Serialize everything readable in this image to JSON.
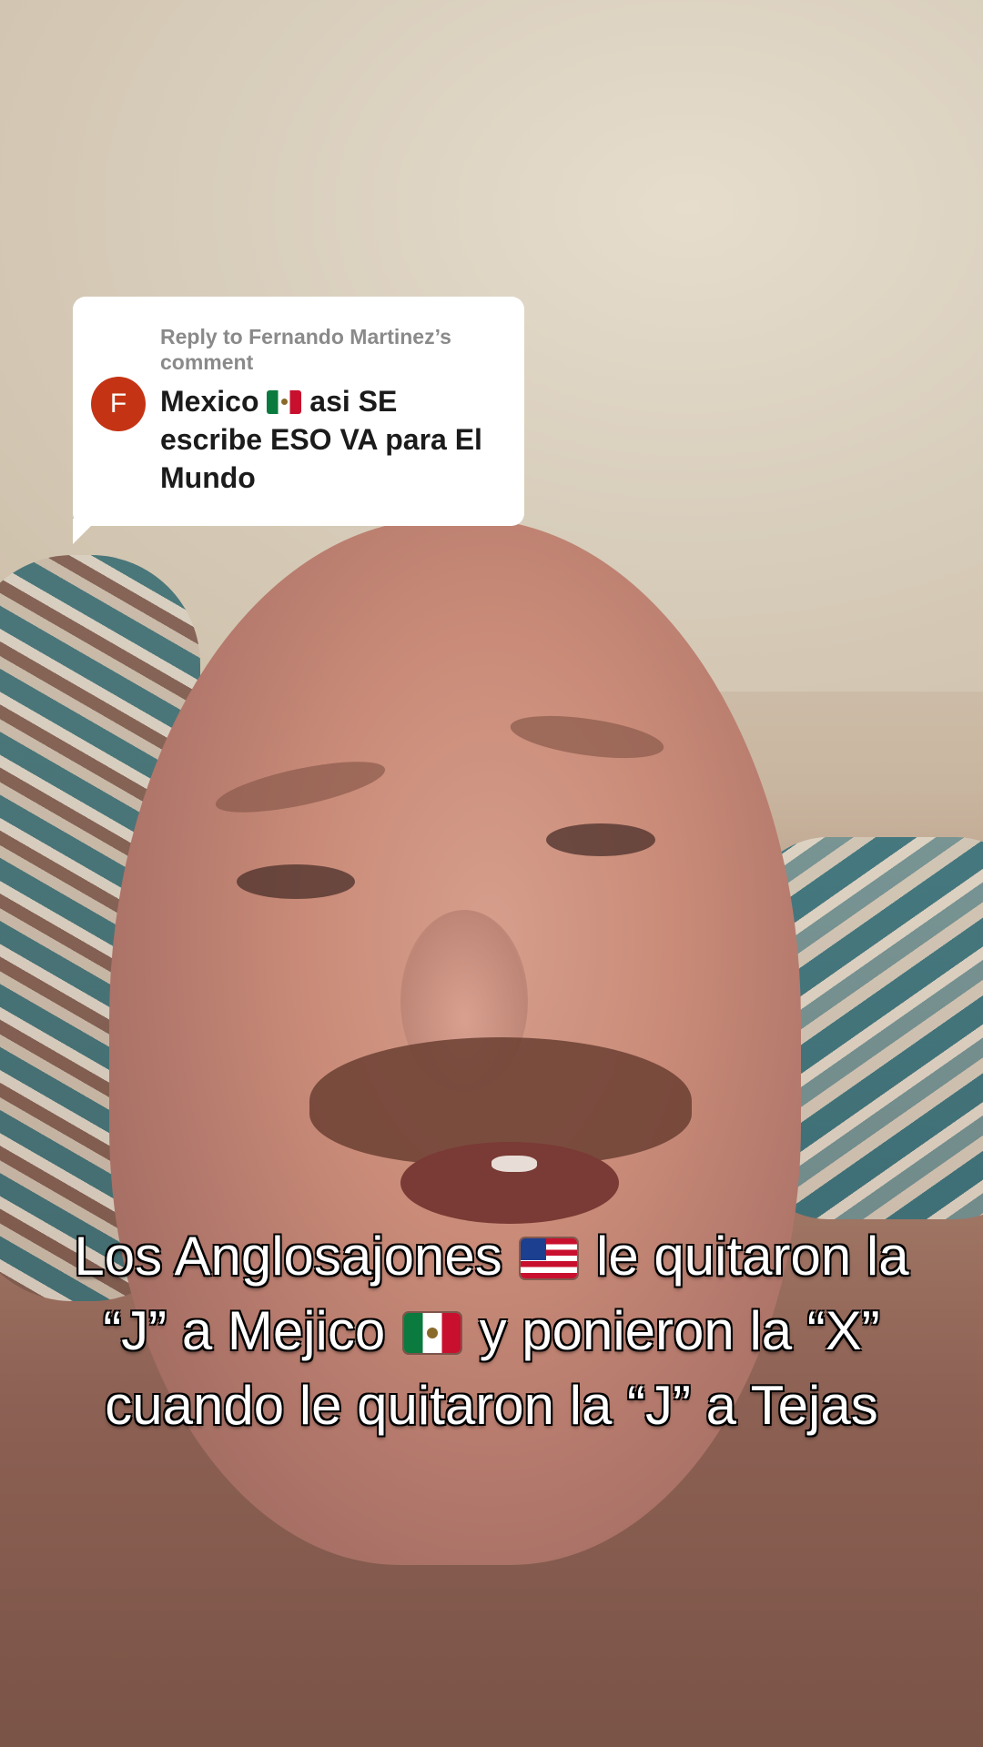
{
  "comment_reply": {
    "header": "Reply to Fernando Martinez’s comment",
    "avatar_initial": "F",
    "avatar_color": "#c43414",
    "text_part1": "Mexico ",
    "flag_icon": "mexico-flag",
    "text_part2": " asi SE escribe ESO VA para El Mundo"
  },
  "caption": {
    "part1": "Los Anglosajones ",
    "flag1": "us-flag",
    "part2": " le quitaron la “J” a Mejico ",
    "flag2": "mexico-flag",
    "part3": " y ponieron la “X” cuando le quitaron la “J” a Tejas"
  }
}
